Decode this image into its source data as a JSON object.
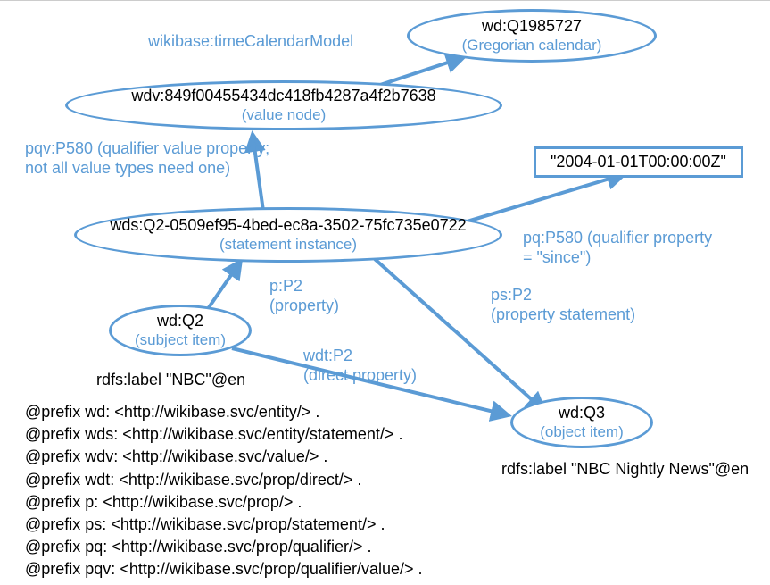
{
  "nodes": {
    "gregorian": {
      "title": "wd:Q1985727",
      "subtitle": "(Gregorian calendar)"
    },
    "valueNode": {
      "title": "wdv:849f00455434dc418fb4287a4f2b7638",
      "subtitle": "(value node)"
    },
    "statement": {
      "title": "wds:Q2-0509ef95-4bed-ec8a-3502-75fc735e0722",
      "subtitle": "(statement instance)"
    },
    "subject": {
      "title": "wd:Q2",
      "subtitle": "(subject item)"
    },
    "object": {
      "title": "wd:Q3",
      "subtitle": "(object item)"
    },
    "literal": {
      "title": "\"2004-01-01T00:00:00Z\""
    }
  },
  "edges": {
    "timeCalendarModel": "wikibase:timeCalendarModel",
    "pqv": {
      "line1": "pqv:P580 (qualifier value property;",
      "line2": "not all value types need one)"
    },
    "pq": {
      "line1": "pq:P580 (qualifier property",
      "line2": "= \"since\")"
    },
    "p": {
      "line1": "p:P2",
      "line2": "(property)"
    },
    "ps": {
      "line1": "ps:P2",
      "line2": "(property statement)"
    },
    "wdt": {
      "line1": "wdt:P2",
      "line2": "(direct property)"
    }
  },
  "labels": {
    "subject": "rdfs:label \"NBC\"@en",
    "object": "rdfs:label \"NBC Nightly News\"@en"
  },
  "prefixes": "@prefix wd: <http://wikibase.svc/entity/> .\n@prefix wds: <http://wikibase.svc/entity/statement/> .\n@prefix wdv: <http://wikibase.svc/value/> .\n@prefix wdt: <http://wikibase.svc/prop/direct/> .\n@prefix p: <http://wikibase.svc/prop/> .\n@prefix ps: <http://wikibase.svc/prop/statement/> .\n@prefix pq: <http://wikibase.svc/prop/qualifier/> .\n@prefix pqv: <http://wikibase.svc/prop/qualifier/value/> ."
}
